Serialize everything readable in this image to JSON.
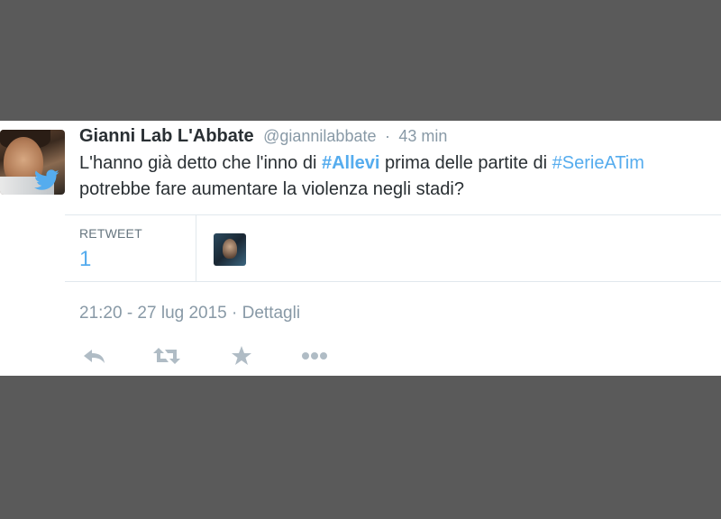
{
  "tweet": {
    "author_name": "Gianni Lab L'Abbate",
    "handle": "@giannilabbate",
    "separator": "·",
    "time_ago": "43 min",
    "text_line1_before": "L'hanno già detto che l'inno di ",
    "hashtag1": "#Allevi",
    "text_line1_middle": " prima delle partite di ",
    "hashtag2": "#SerieATim",
    "text_line2": "potrebbe fare aumentare la violenza negli stadi?"
  },
  "stats": {
    "retweet_label": "RETWEET",
    "retweet_count": "1"
  },
  "footer": {
    "timestamp": "21:20 - 27 lug 2015",
    "separator": " · ",
    "details_label": "Dettagli"
  },
  "actions": {
    "reply_icon": "reply-icon",
    "retweet_icon": "retweet-icon",
    "favorite_icon": "star-icon",
    "more_icon": "more-dots-icon"
  },
  "colors": {
    "background": "#5a5a5a",
    "card": "#ffffff",
    "text": "#292f33",
    "muted": "#8899a6",
    "link": "#55acee",
    "icon": "#b0bcc5"
  }
}
